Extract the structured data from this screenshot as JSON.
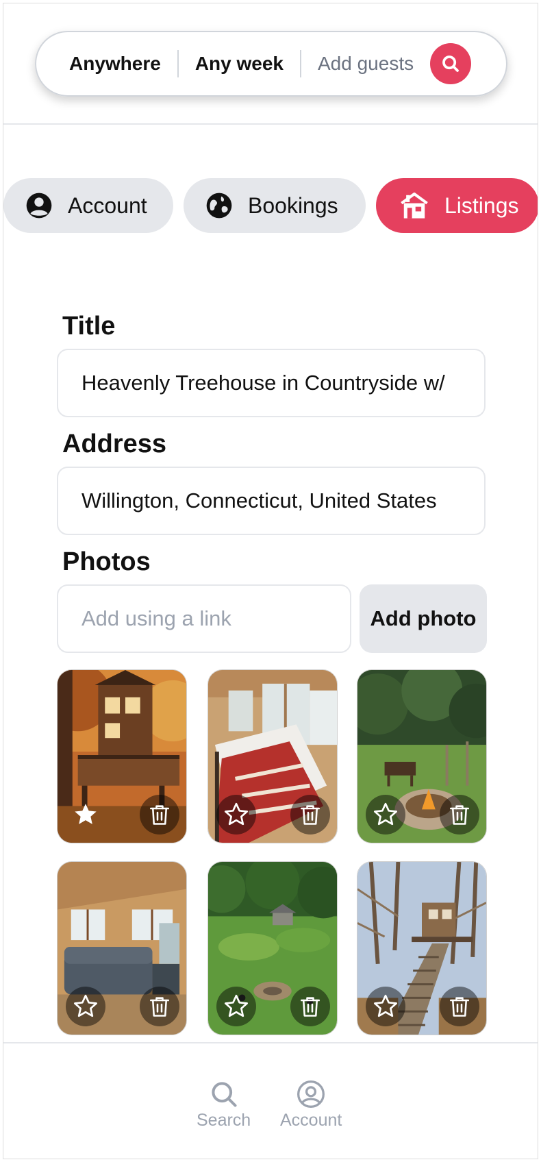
{
  "search_bar": {
    "location": "Anywhere",
    "week": "Any week",
    "guests_placeholder": "Add guests",
    "button_icon": "search-icon"
  },
  "tabs": [
    {
      "label": "Account",
      "icon": "user-circle-icon",
      "active": false
    },
    {
      "label": "Bookings",
      "icon": "globe-icon",
      "active": false
    },
    {
      "label": "Listings",
      "icon": "house-icon",
      "active": true
    }
  ],
  "form": {
    "title_label": "Title",
    "title_value": "Heavenly Treehouse in Countryside w/",
    "address_label": "Address",
    "address_value": "Willington, Connecticut, United States",
    "photos_label": "Photos",
    "photo_link_placeholder": "Add using a link",
    "add_photo_button": "Add photo"
  },
  "photos": [
    {
      "subject": "treehouse exterior",
      "starred": true
    },
    {
      "subject": "bedroom",
      "starred": false
    },
    {
      "subject": "fire pit yard",
      "starred": false
    },
    {
      "subject": "living room",
      "starred": false
    },
    {
      "subject": "garden aerial",
      "starred": false
    },
    {
      "subject": "staircase to treehouse",
      "starred": false
    }
  ],
  "bottom_nav": {
    "search_label": "Search",
    "account_label": "Account"
  },
  "colors": {
    "accent": "#e5405e",
    "tab_bg": "#e5e7eb",
    "muted_text": "#9ca3af"
  }
}
